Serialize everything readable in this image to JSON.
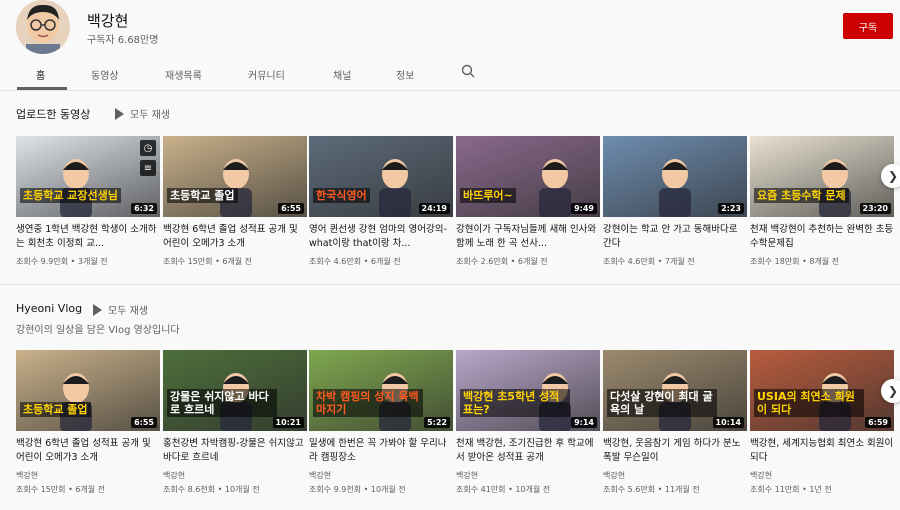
{
  "channel": {
    "name": "백강현",
    "subscribers": "구독자 6.68만명",
    "subscribe_label": "구독"
  },
  "tabs": [
    "홈",
    "동영상",
    "재생목록",
    "커뮤니티",
    "채널",
    "정보"
  ],
  "shelves": [
    {
      "title": "업로드한 동영상",
      "play_all": "모두 재생",
      "videos": [
        {
          "title": "생연중 1학년 백강현 학생이 소개하는 회천초 이정희 교...",
          "meta": "조회수 9.9만회 • 3개월 전",
          "duration": "6:32",
          "caption": "초등학교 교장선생님",
          "thumb_color": "#dfe4ea"
        },
        {
          "title": "백강현 6학년 졸업 성적표 공개 및 어린이 오메가3 소개",
          "meta": "조회수 15만회 • 6개월 전",
          "duration": "6:55",
          "caption": "초등학교 졸업",
          "thumb_color": "#c9b18a"
        },
        {
          "title": "영어 퀸선생 강현 엄마의 영어강의-what이랑 that이랑 차...",
          "meta": "조회수 4.6만회 • 6개월 전",
          "duration": "24:19",
          "caption": "한국식영어",
          "thumb_color": "#5d6b7a"
        },
        {
          "title": "강현이가 구독자님들께 새해 인사와 함께 노래 한 곡 선사...",
          "meta": "조회수 2.6만회 • 6개월 전",
          "duration": "9:49",
          "caption": "바뜨루어~",
          "thumb_color": "#8a6a8c"
        },
        {
          "title": "강현이는 학교 안 가고 동해바다로 간다",
          "meta": "조회수 4.6만회 • 7개월 전",
          "duration": "2:23",
          "caption": "",
          "thumb_color": "#6e8db0"
        },
        {
          "title": "천재 백강현이 추천하는 완벽한 초등수학문제집",
          "meta": "조회수 18만회 • 8개월 전",
          "duration": "23:20",
          "caption": "요즘 초등수학 문제",
          "thumb_color": "#e9e2d2"
        }
      ]
    },
    {
      "title": "Hyeoni Vlog",
      "play_all": "모두 재생",
      "description": "강현이의 일상을 담은 Vlog 영상입니다",
      "videos": [
        {
          "title": "백강현 6학년 졸업 성적표 공개 및 어린이 오메가3 소개",
          "channel": "백강현",
          "meta": "조회수 15만회 • 6개월 전",
          "duration": "6:55",
          "caption": "초등학교 졸업",
          "thumb_color": "#c9b18a"
        },
        {
          "title": "홍천강변 차박캠핑-강물은 쉬지않고 바다로 흐르네",
          "channel": "백강현",
          "meta": "조회수 8.6천회 • 10개월 전",
          "duration": "10:21",
          "caption": "강물은 쉬지않고 바다로 흐르네",
          "thumb_color": "#4d6f3b"
        },
        {
          "title": "일생에 한번은 꼭 가봐야 할 우리나라 캠핑장소",
          "channel": "백강현",
          "meta": "조회수 9.9천회 • 10개월 전",
          "duration": "5:22",
          "caption": "차박 캠핑의 성지 육백마지기",
          "thumb_color": "#7fa84f"
        },
        {
          "title": "천재 백강현, 조기진급한 후 학교에서 받아온 성적표 공개",
          "channel": "백강현",
          "meta": "조회수 41만회 • 10개월 전",
          "duration": "9:14",
          "caption": "백강현 초5학년 성적표는?",
          "thumb_color": "#b9a6c9"
        },
        {
          "title": "백강현, 웃음참기 게임 하다가 분노 폭발 무슨일이",
          "channel": "백강현",
          "meta": "조회수 5.6만회 • 11개월 전",
          "duration": "10:14",
          "caption": "다섯살 강현이 최대 굴욕의 날",
          "thumb_color": "#9c8a6e"
        },
        {
          "title": "백강현, 세계지능협회 최연소 회원이 되다",
          "channel": "백강현",
          "meta": "조회수 11만회 • 1년 전",
          "duration": "6:59",
          "caption": "USIA의 최연소 회원이 되다",
          "thumb_color": "#b85c3e"
        }
      ]
    }
  ]
}
